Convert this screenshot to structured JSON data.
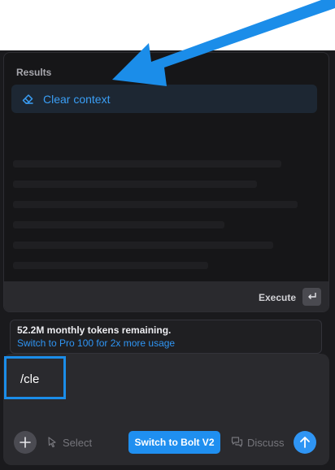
{
  "command_palette": {
    "section_label": "Results",
    "items": [
      {
        "label": "Clear context",
        "icon": "eraser-icon",
        "selected": true
      }
    ],
    "execute_label": "Execute",
    "execute_key_icon": "enter-key-icon"
  },
  "usage_banner": {
    "tokens_text": "52.2M monthly tokens remaining.",
    "upgrade_link": "Switch to Pro 100 for 2x more usage"
  },
  "composer": {
    "input_value": "/cle",
    "actions": {
      "add_icon": "plus-icon",
      "select_label": "Select",
      "switch_label": "Switch to Bolt V2",
      "discuss_label": "Discuss",
      "send_icon": "arrow-up-icon"
    }
  },
  "colors": {
    "accent": "#2f95f4",
    "annotation": "#1b8de9"
  }
}
